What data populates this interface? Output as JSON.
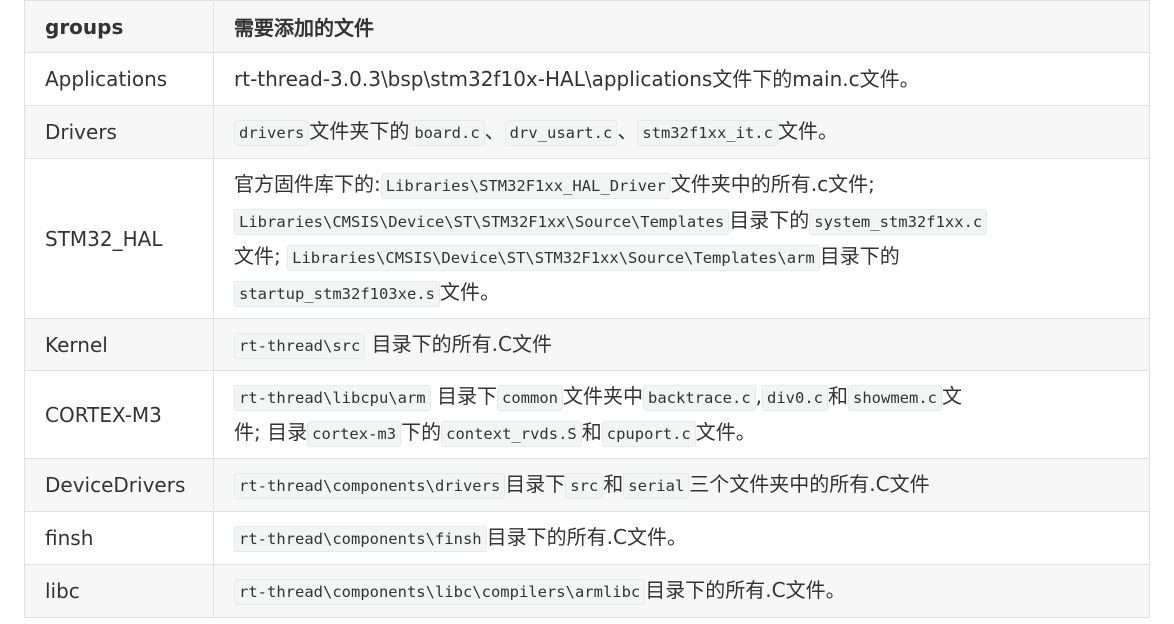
{
  "table": {
    "headers": [
      "groups",
      "需要添加的文件"
    ],
    "rows": [
      {
        "group": "Applications",
        "parts": [
          {
            "t": "text",
            "v": "rt-thread-3.0.3\\bsp\\stm32f10x-HAL\\applications文件下的main.c文件。"
          }
        ]
      },
      {
        "group": "Drivers",
        "parts": [
          {
            "t": "code",
            "v": "drivers"
          },
          {
            "t": "text",
            "v": "文件夹下的"
          },
          {
            "t": "code",
            "v": "board.c"
          },
          {
            "t": "text",
            "v": "、"
          },
          {
            "t": "code",
            "v": "drv_usart.c"
          },
          {
            "t": "text",
            "v": "、"
          },
          {
            "t": "code",
            "v": "stm32f1xx_it.c"
          },
          {
            "t": "text",
            "v": "文件。"
          }
        ]
      },
      {
        "group": "STM32_HAL",
        "parts": [
          {
            "t": "text",
            "v": "官方固件库下的:"
          },
          {
            "t": "code",
            "v": "Libraries\\STM32F1xx_HAL_Driver"
          },
          {
            "t": "text",
            "v": "文件夹中的所有.c文件;"
          },
          {
            "t": "br",
            "v": ""
          },
          {
            "t": "code",
            "v": "Libraries\\CMSIS\\Device\\ST\\STM32F1xx\\Source\\Templates"
          },
          {
            "t": "text",
            "v": "目录下的"
          },
          {
            "t": "code",
            "v": "system_stm32f1xx.c"
          },
          {
            "t": "br",
            "v": ""
          },
          {
            "t": "text",
            "v": "文件; "
          },
          {
            "t": "code",
            "v": "Libraries\\CMSIS\\Device\\ST\\STM32F1xx\\Source\\Templates\\arm"
          },
          {
            "t": "text",
            "v": "目录下的"
          },
          {
            "t": "br",
            "v": ""
          },
          {
            "t": "code",
            "v": "startup_stm32f103xe.s"
          },
          {
            "t": "text",
            "v": "文件。"
          }
        ]
      },
      {
        "group": "Kernel",
        "parts": [
          {
            "t": "code",
            "v": "rt-thread\\src"
          },
          {
            "t": "text",
            "v": " 目录下的所有.C文件"
          }
        ]
      },
      {
        "group": "CORTEX-M3",
        "parts": [
          {
            "t": "code",
            "v": "rt-thread\\libcpu\\arm"
          },
          {
            "t": "text",
            "v": " 目录下"
          },
          {
            "t": "code",
            "v": "common"
          },
          {
            "t": "text",
            "v": "文件夹中"
          },
          {
            "t": "code",
            "v": "backtrace.c"
          },
          {
            "t": "text",
            "v": ","
          },
          {
            "t": "code",
            "v": "div0.c"
          },
          {
            "t": "text",
            "v": "和"
          },
          {
            "t": "code",
            "v": "showmem.c"
          },
          {
            "t": "text",
            "v": "文"
          },
          {
            "t": "br",
            "v": ""
          },
          {
            "t": "text",
            "v": "件; 目录"
          },
          {
            "t": "code",
            "v": "cortex-m3"
          },
          {
            "t": "text",
            "v": "下的"
          },
          {
            "t": "code",
            "v": "context_rvds.S"
          },
          {
            "t": "text",
            "v": "和"
          },
          {
            "t": "code",
            "v": "cpuport.c"
          },
          {
            "t": "text",
            "v": "文件。"
          }
        ]
      },
      {
        "group": "DeviceDrivers",
        "parts": [
          {
            "t": "code",
            "v": "rt-thread\\components\\drivers"
          },
          {
            "t": "text",
            "v": "目录下"
          },
          {
            "t": "code",
            "v": "src"
          },
          {
            "t": "text",
            "v": "和"
          },
          {
            "t": "code",
            "v": "serial"
          },
          {
            "t": "text",
            "v": "三个文件夹中的所有.C文件"
          }
        ]
      },
      {
        "group": "finsh",
        "parts": [
          {
            "t": "code",
            "v": "rt-thread\\components\\finsh"
          },
          {
            "t": "text",
            "v": "目录下的所有.C文件。"
          }
        ]
      },
      {
        "group": "libc",
        "parts": [
          {
            "t": "code",
            "v": "rt-thread\\components\\libc\\compilers\\armlibc"
          },
          {
            "t": "text",
            "v": "目录下的所有.C文件。"
          }
        ]
      }
    ]
  }
}
